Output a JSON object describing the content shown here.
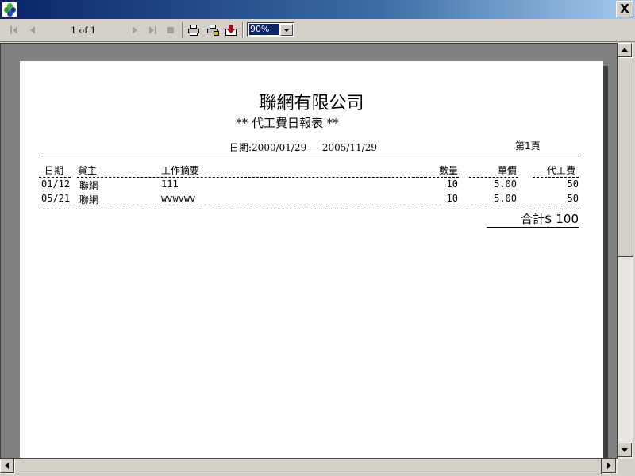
{
  "window": {
    "close_label": "X"
  },
  "toolbar": {
    "page_label": "1 of 1",
    "zoom_value": "90%",
    "icons": [
      "first-page-icon",
      "prev-page-icon",
      "next-page-icon",
      "last-page-icon",
      "stop-icon",
      "print-icon",
      "print-setup-icon",
      "export-icon"
    ]
  },
  "report": {
    "company": "聯網有限公司",
    "title": "** 代工費日報表 **",
    "date_range": "日期:2000/01/29 — 2005/11/29",
    "page_no": "第1頁",
    "columns": {
      "date": "日期",
      "owner": "貨主",
      "desc": "工作摘要",
      "qty": "數量",
      "price": "單價",
      "fee": "代工費"
    },
    "rows": [
      {
        "date": "01/12",
        "owner": "聯網",
        "desc": "111",
        "qty": "10",
        "price": "5.00",
        "fee": "50"
      },
      {
        "date": "05/21",
        "owner": "聯網",
        "desc": "wvwvwv",
        "qty": "10",
        "price": "5.00",
        "fee": "50"
      }
    ],
    "total": "合計$ 100"
  },
  "colors": {
    "title_gradient_start": "#0a246a",
    "title_gradient_end": "#a6caf0",
    "face": "#d4d0c8",
    "viewport": "#808080"
  }
}
